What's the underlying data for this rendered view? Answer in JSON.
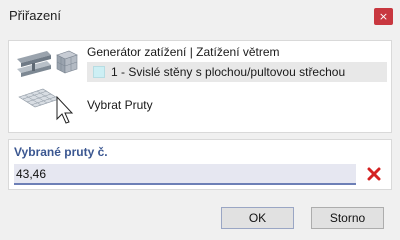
{
  "window": {
    "title": "Přiřazení",
    "close_glyph": "×",
    "close_color": "#c8373f"
  },
  "generator": {
    "title": "Generátor zatížení | Zatížení větrem",
    "item_label": "1 - Svislé stěny s plochou/pultovou střechou",
    "item_color": "#cdeff4",
    "action": "Vybrat Pruty",
    "icon": "wind-load-generator-icon"
  },
  "selection": {
    "label": "Vybrané pruty č.",
    "value": "43,46",
    "clear_icon": "red-x-icon",
    "label_color": "#3b5791"
  },
  "buttons": {
    "ok": "OK",
    "cancel": "Storno"
  }
}
